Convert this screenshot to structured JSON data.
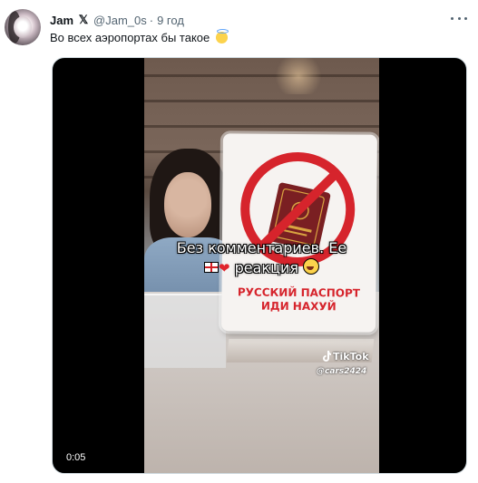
{
  "tweet": {
    "author_name": "Jam",
    "badge": "𝕏",
    "handle": "@Jam_0s",
    "separator": "·",
    "time": "9 год",
    "text": "Во всех аэропортах бы такое",
    "text_emoji": "smiling-face-with-halo-emoji"
  },
  "media": {
    "caption_line1": "Без комментариев. Ее",
    "caption_line2": "реакция",
    "sign_line1": "РУССКИЙ ПАСПОРТ",
    "sign_line2": "ИДИ НАХУЙ",
    "tiktok_brand": "TikTok",
    "tiktok_user": "@cars2424",
    "duration": "0:05"
  },
  "colors": {
    "text_primary": "#0f1419",
    "text_secondary": "#536471",
    "sign_red": "#d6242c",
    "media_bg": "#000000"
  }
}
